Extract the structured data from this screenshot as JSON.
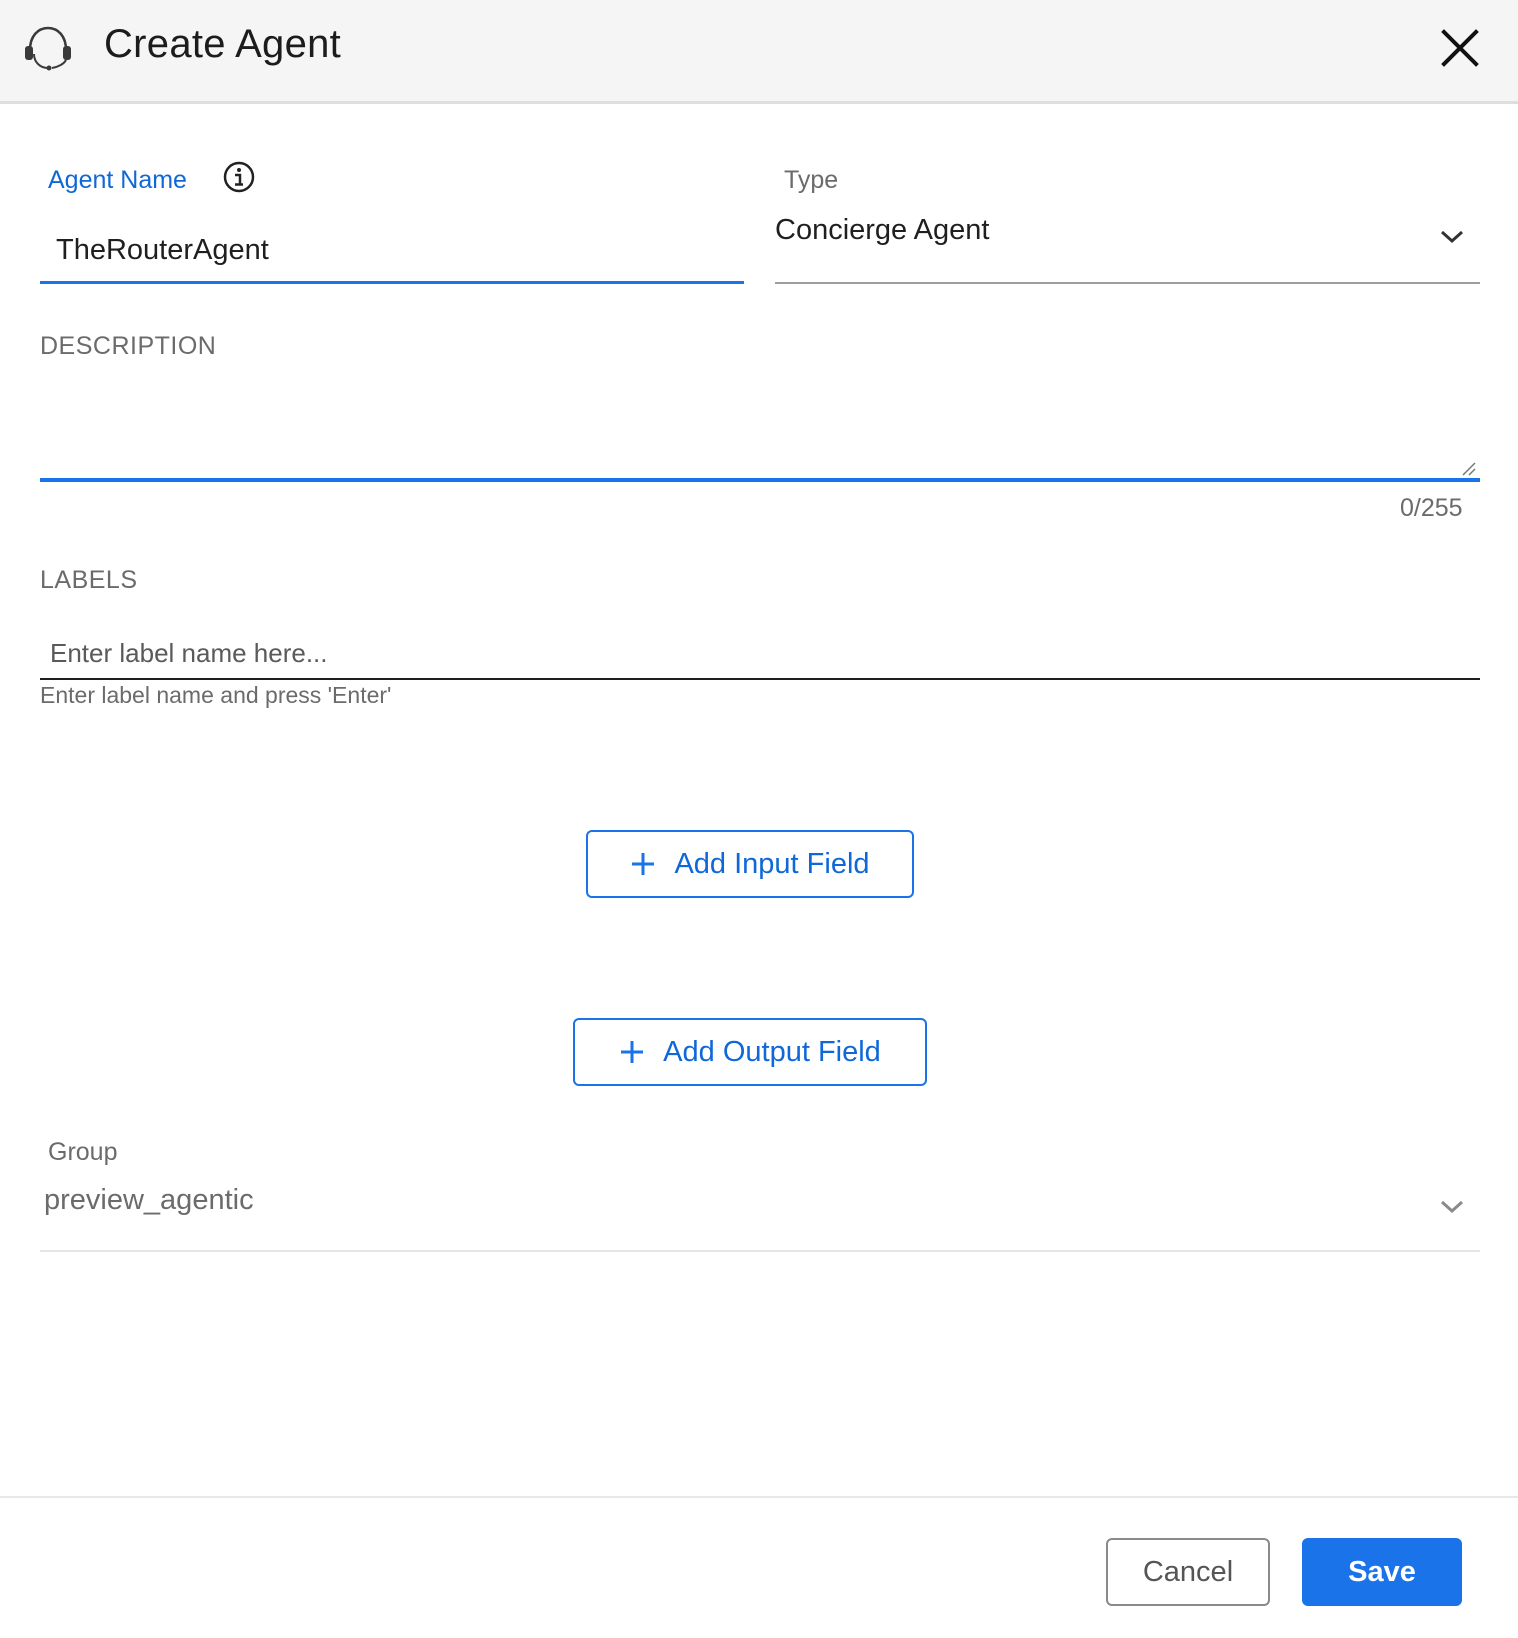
{
  "dialog": {
    "title": "Create Agent",
    "header_icon": "headset-icon",
    "close_icon": "close-icon"
  },
  "agent_name": {
    "label": "Agent Name",
    "value": "TheRouterAgent",
    "info_icon": "info-icon"
  },
  "type": {
    "label": "Type",
    "value": "Concierge Agent",
    "icon": "chevron-down-icon"
  },
  "description": {
    "label": "DESCRIPTION",
    "value": "",
    "counter": "0/255"
  },
  "labels": {
    "label": "LABELS",
    "placeholder": "Enter label name here...",
    "helper": "Enter label name and press 'Enter'"
  },
  "actions": {
    "add_input": "Add Input Field",
    "add_output": "Add Output Field",
    "plus_icon": "plus-icon"
  },
  "group": {
    "label": "Group",
    "value": "preview_agentic",
    "icon": "chevron-down-icon"
  },
  "footer": {
    "cancel": "Cancel",
    "save": "Save"
  },
  "colors": {
    "accent": "#1a73e8",
    "header_bg": "#f5f5f5",
    "label_blue": "#1068d8",
    "muted_text": "#6b6b6b"
  }
}
